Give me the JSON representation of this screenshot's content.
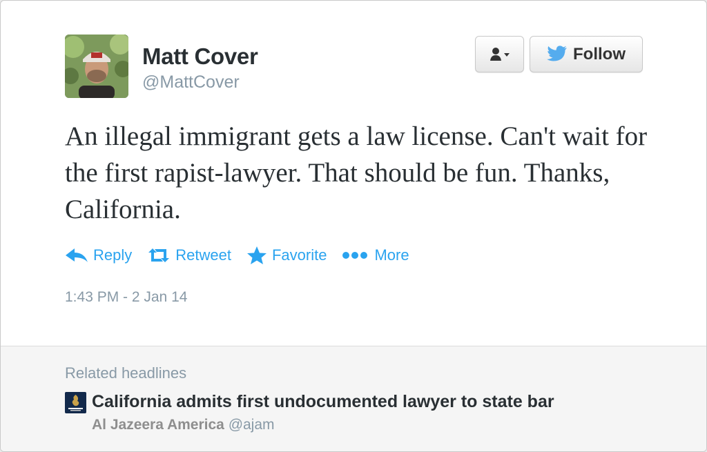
{
  "user": {
    "name": "Matt Cover",
    "handle": "@MattCover"
  },
  "buttons": {
    "follow_label": "Follow"
  },
  "tweet": {
    "text": "An illegal immigrant gets a law license. Can't wait for the first rapist-lawyer. That should be fun. Thanks, California.",
    "timestamp": "1:43 PM - 2 Jan 14"
  },
  "actions": {
    "reply": "Reply",
    "retweet": "Retweet",
    "favorite": "Favorite",
    "more": "More"
  },
  "related": {
    "title": "Related headlines",
    "headline": "California admits first undocumented lawyer to state bar",
    "source_name": "Al Jazeera America",
    "source_handle": "@ajam"
  },
  "colors": {
    "accent": "#2aa3ef",
    "name": "#292f33",
    "muted": "#8899a6",
    "twitter_blue": "#55acee"
  },
  "icons": {
    "follow": "twitter-bird-icon",
    "user_menu": "user-dropdown-icon",
    "reply": "reply-arrow-icon",
    "retweet": "retweet-icon",
    "favorite": "star-icon",
    "more": "dots-icon"
  }
}
